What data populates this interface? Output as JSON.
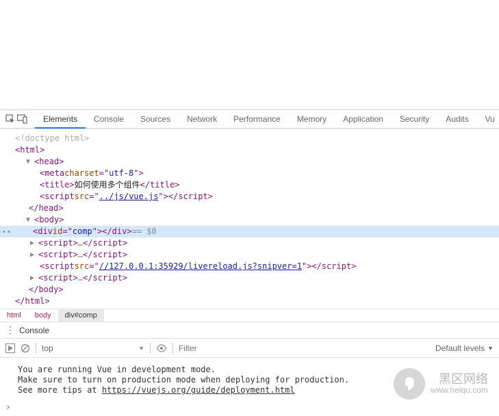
{
  "tabs": [
    "Elements",
    "Console",
    "Sources",
    "Network",
    "Performance",
    "Memory",
    "Application",
    "Security",
    "Audits",
    "Vu"
  ],
  "active_tab": 0,
  "dom": {
    "doctype": "<!doctype html>",
    "html_open": "html",
    "head_open": "head",
    "meta_attr_name": "charset",
    "meta_attr_val": "utf-8",
    "title_text": "如何使用多个组件",
    "script_src1": "../js/vue.js",
    "head_close": "/head",
    "body_open": "body",
    "div_id_attr": "id",
    "div_id_val": "comp",
    "eq0": " == $0",
    "script_ellipsis": "…",
    "script_src2": "//127.0.0.1:35929/livereload.js?snipver=1",
    "body_close": "/body",
    "html_close": "/html"
  },
  "breadcrumb": [
    "html",
    "body",
    "div#comp"
  ],
  "console": {
    "title": "Console",
    "context": "top",
    "filter_placeholder": "Filter",
    "levels": "Default levels",
    "lines": [
      "You are running Vue in development mode.",
      "Make sure to turn on production mode when deploying for production.",
      "See more tips at "
    ],
    "link": "https://vuejs.org/guide/deployment.html"
  },
  "watermark": {
    "title": "黑区网络",
    "url": "www.heiqu.com"
  },
  "icons": {
    "inspect": "inspect-icon",
    "device": "device-toggle-icon",
    "kebab": "⋮",
    "play": "play-icon",
    "clear": "clear-icon",
    "eye": "eye-icon",
    "tri_down": "▼",
    "tri_right": "▶",
    "prompt": "›"
  }
}
